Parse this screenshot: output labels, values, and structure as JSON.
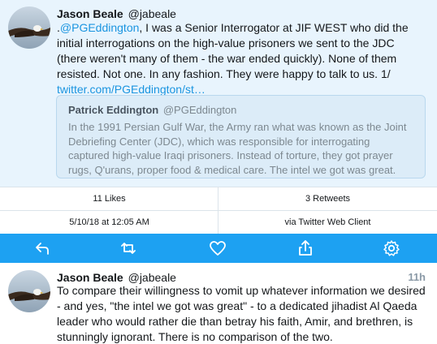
{
  "main_tweet": {
    "display_name": "Jason Beale",
    "handle": "@jabeale",
    "text_prefix": ".",
    "mention": "@PGEddington",
    "text_body": ", I was a Senior Interrogator at JIF WEST who did the initial interrogations on the high-value prisoners we sent to the JDC (there weren't many of them - the war ended quickly). None of them resisted. Not one. In any fashion. They were happy to talk to us. 1/ ",
    "link": "twitter.com/PGEddington/st…"
  },
  "quoted_tweet": {
    "display_name": "Patrick Eddington",
    "handle": "@PGEddington",
    "text": "In the 1991 Persian Gulf War, the Army ran what was known as the Joint Debriefing Center (JDC), which was responsible for interrogating captured high-value Iraqi prisoners. Instead of torture, they got prayer rugs, Q'urans, proper food & medical care. The intel we got was great."
  },
  "stats": {
    "likes": "11 Likes",
    "retweets": "3 Retweets",
    "date": "5/10/18 at 12:05 AM",
    "client": "via Twitter Web Client"
  },
  "actions": {
    "icons": [
      "reply-icon",
      "retweet-icon",
      "like-icon",
      "share-icon",
      "settings-icon"
    ],
    "bar_color": "#1da1f2"
  },
  "reply_tweet": {
    "display_name": "Jason Beale",
    "handle": "@jabeale",
    "time": "11h",
    "text": "To compare their willingness to vomit up whatever information we desired - and yes, \"the intel we got was great\" - to a dedicated jihadist Al Qaeda leader who would rather die than betray his faith, Amir, and brethren, is stunningly ignorant. There is no comparison of the two."
  },
  "colors": {
    "link": "#1b95e0",
    "selected_bg": "#e8f4fd",
    "quote_bg": "#dcecf8"
  }
}
